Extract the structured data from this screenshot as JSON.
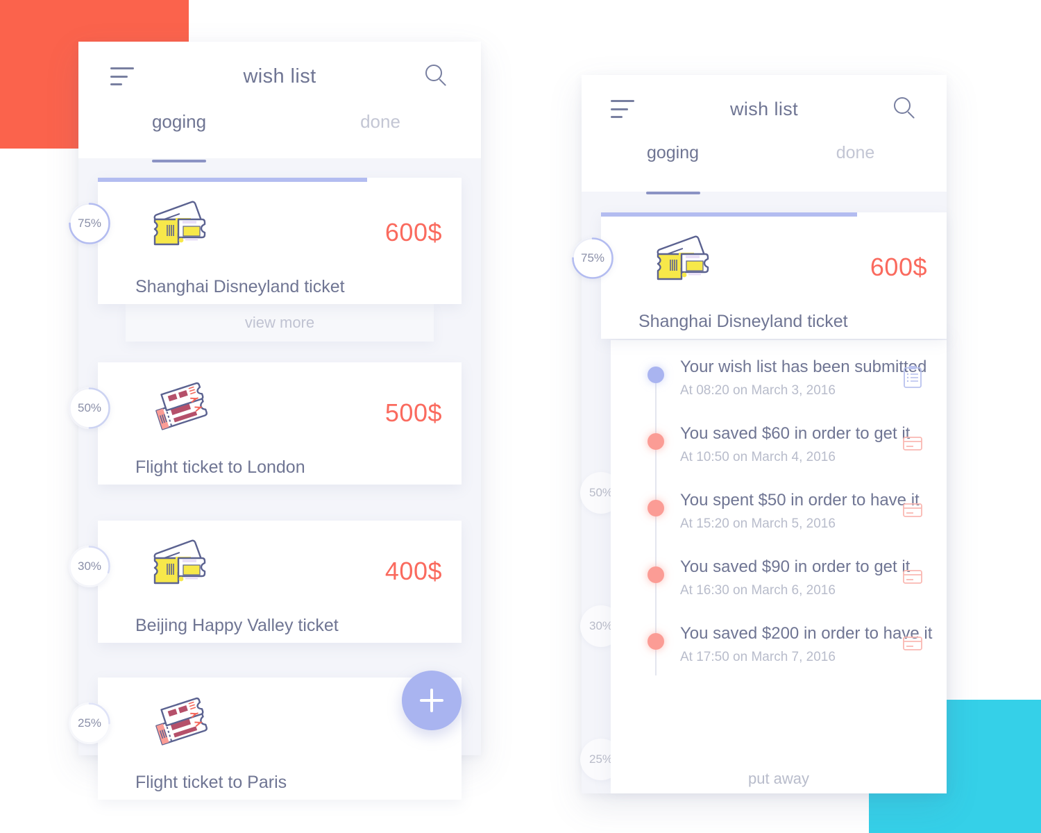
{
  "theme": {
    "coral_square": "#FB634C",
    "teal_square": "#35D0E8",
    "accent_periwinkle": "#A9B4F0",
    "price_red": "#FA6A5E",
    "text_primary": "#6F7593",
    "text_muted": "#C3C6D4"
  },
  "phone_left": {
    "header": {
      "menu_icon": "hamburger-icon",
      "title": "wish list",
      "search_icon": "search-icon"
    },
    "tabs": [
      {
        "label": "goging",
        "active": true
      },
      {
        "label": "done",
        "active": false
      }
    ],
    "items": [
      {
        "progress": "75%",
        "title": "Shanghai Disneyland ticket",
        "price": "600$",
        "icon": "yellow-ticket-icon",
        "expanded": true,
        "view_more_label": "view more"
      },
      {
        "progress": "50%",
        "title": "Flight ticket to London",
        "price": "500$",
        "icon": "red-flight-ticket-icon",
        "expanded": false
      },
      {
        "progress": "30%",
        "title": "Beijing Happy Valley ticket",
        "price": "400$",
        "icon": "yellow-ticket-icon",
        "expanded": false
      },
      {
        "progress": "25%",
        "title": "Flight ticket to Paris",
        "price": "",
        "icon": "red-flight-ticket-icon",
        "expanded": false
      }
    ],
    "fab": {
      "icon": "plus-icon",
      "label": "+"
    }
  },
  "phone_right": {
    "header": {
      "menu_icon": "hamburger-icon",
      "title": "wish list",
      "search_icon": "search-icon"
    },
    "tabs": [
      {
        "label": "goging",
        "active": true
      },
      {
        "label": "done",
        "active": false
      }
    ],
    "featured_item": {
      "progress": "75%",
      "title": "Shanghai Disneyland ticket",
      "price": "600$",
      "icon": "yellow-ticket-icon"
    },
    "background_items": [
      {
        "progress": "50%"
      },
      {
        "progress": "30%"
      },
      {
        "progress": "25%"
      }
    ],
    "timeline": [
      {
        "text": "Your wish list has been submitted",
        "time": "At 08:20 on  March 3, 2016",
        "dot": "blue",
        "icon": "clipboard-icon"
      },
      {
        "text": "You saved $60 in order to get it",
        "time": "At 10:50 on  March 4, 2016",
        "dot": "red",
        "icon": "credit-card-icon"
      },
      {
        "text": "You spent $50 in order to have it",
        "time": "At 15:20 on  March 5, 2016",
        "dot": "red",
        "icon": "credit-card-icon"
      },
      {
        "text": "You saved $90 in order to get it",
        "time": "At 16:30 on  March 6, 2016",
        "dot": "red",
        "icon": "credit-card-icon"
      },
      {
        "text": "You saved $200 in order to have it",
        "time": "At 17:50 on  March 7, 2016",
        "dot": "red",
        "icon": "credit-card-icon"
      }
    ],
    "put_away_label": "put away"
  }
}
